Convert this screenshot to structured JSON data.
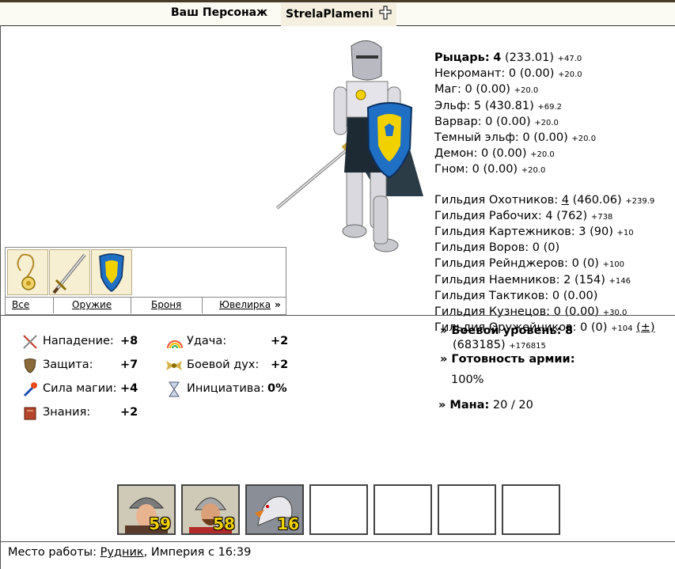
{
  "header": {
    "title": "Ваш Персонаж",
    "nickname": "StrelaPlameni"
  },
  "factions": [
    {
      "name": "Рыцарь:",
      "level": "4",
      "points": "(233.01)",
      "next": "+47.0"
    },
    {
      "name": "Некромант:",
      "level": "0",
      "points": "(0.00)",
      "next": "+20.0"
    },
    {
      "name": "Маг:",
      "level": "0",
      "points": "(0.00)",
      "next": "+20.0"
    },
    {
      "name": "Эльф:",
      "level": "5",
      "points": "(430.81)",
      "next": "+69.2"
    },
    {
      "name": "Варвар:",
      "level": "0",
      "points": "(0.00)",
      "next": "+20.0"
    },
    {
      "name": "Темный эльф:",
      "level": "0",
      "points": "(0.00)",
      "next": "+20.0"
    },
    {
      "name": "Демон:",
      "level": "0",
      "points": "(0.00)",
      "next": "+20.0"
    },
    {
      "name": "Гном:",
      "level": "0",
      "points": "(0.00)",
      "next": "+20.0"
    }
  ],
  "guilds": [
    {
      "name": "Гильдия Охотников:",
      "level": "4",
      "points": "(460.06)",
      "next": "+239.9"
    },
    {
      "name": "Гильдия Рабочих:",
      "level": "4",
      "points": "(762)",
      "next": "+738"
    },
    {
      "name": "Гильдия Картежников:",
      "level": "3",
      "points": "(90)",
      "next": "+10"
    },
    {
      "name": "Гильдия Воров:",
      "level": "0",
      "points": "(0)",
      "next": ""
    },
    {
      "name": "Гильдия Рейнджеров:",
      "level": "0",
      "points": "(0)",
      "next": "+100"
    },
    {
      "name": "Гильдия Наемников:",
      "level": "2",
      "points": "(154)",
      "next": "+146"
    },
    {
      "name": "Гильдия Тактиков:",
      "level": "0",
      "points": "(0.00)",
      "next": ""
    },
    {
      "name": "Гильдия Кузнецов:",
      "level": "0",
      "points": "(0.00)",
      "next": "+30.0"
    },
    {
      "name": "Гильдия Оружейников:",
      "level": "0",
      "points": "(0)",
      "next": "+104",
      "extra": "(±)"
    }
  ],
  "inventory": {
    "tabs": [
      "Все",
      "Оружие",
      "Броня",
      "Ювелирка"
    ],
    "more": "»",
    "items": [
      "amulet-icon",
      "sword-icon",
      "shield-icon"
    ]
  },
  "attributes": {
    "attack_label": "Нападение:",
    "attack": "+8",
    "defense_label": "Защита:",
    "defense": "+7",
    "magic_label": "Сила магии:",
    "magic": "+4",
    "knowledge_label": "Знания:",
    "knowledge": "+2",
    "luck_label": "Удача:",
    "luck": "+2",
    "morale_label": "Боевой дух:",
    "morale": "+2",
    "initiative_label": "Инициатива:",
    "initiative": "0%"
  },
  "combat": {
    "level_label": "Боевой уровень:",
    "level": "8",
    "exp": "(683185)",
    "exp_next": "+176815",
    "readiness_label": "Готовность армии:",
    "readiness": "100%",
    "mana_label": "Мана:",
    "mana": "20 / 20"
  },
  "army": [
    {
      "unit": "footman-icon",
      "count": "59"
    },
    {
      "unit": "swordsman-icon",
      "count": "58"
    },
    {
      "unit": "griffin-icon",
      "count": "16"
    },
    {
      "unit": "",
      "count": ""
    },
    {
      "unit": "",
      "count": ""
    },
    {
      "unit": "",
      "count": ""
    },
    {
      "unit": "",
      "count": ""
    }
  ],
  "footer": {
    "work_label": "Место работы:",
    "work_place": "Рудник",
    "work_rest": ", Империя с 16:39"
  },
  "colors": {
    "accent_gold": "#f2d100",
    "shield_blue": "#1f6fc4",
    "attack_red": "#c0392b"
  }
}
